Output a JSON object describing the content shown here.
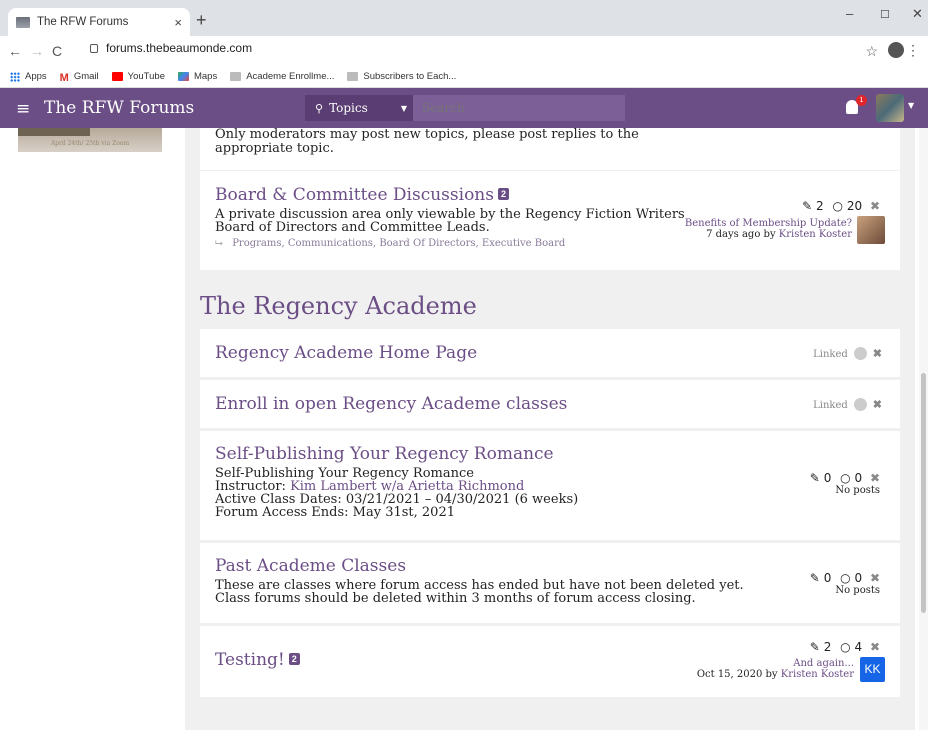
{
  "browser": {
    "tab_title": "The RFW Forums",
    "tab_close": "×",
    "new_tab": "+",
    "url": "forums.thebeaumonde.com",
    "min": "–",
    "max": "☐",
    "close": "✕",
    "bookmarks": [
      "Apps",
      "Gmail",
      "YouTube",
      "Maps",
      "Academe Enrollme...",
      "Subscribers to Each..."
    ]
  },
  "header": {
    "brand": "The RFW Forums",
    "search_scope": "Topics",
    "search_placeholder": "Search",
    "notif_count": "1"
  },
  "sidebar": {
    "banner_text": "April 24th/ 25th via Zoom"
  },
  "cards": {
    "top_text": "Only moderators may post new topics, please post replies to the appropriate topic.",
    "board": {
      "title": "Board & Committee Discussions",
      "unread": "2",
      "desc": "A private discussion area only viewable by the Regency Fiction Writers Board of Directors and Committee Leads.",
      "subs": [
        "Programs,",
        "Communications,",
        "Board Of Directors,",
        "Executive Board"
      ],
      "topics": "2",
      "posts": "20",
      "last_title": "Benefits of Membership Update?",
      "last_time": "7 days ago by",
      "last_user": "Kristen Koster"
    },
    "section_title": "The Regency Academe",
    "home": {
      "title": "Regency Academe Home Page",
      "linked": "Linked"
    },
    "enroll": {
      "title": "Enroll in open Regency Academe classes",
      "linked": "Linked"
    },
    "selfpub": {
      "title": "Self-Publishing Your Regency Romance",
      "line1": "Self-Publishing Your Regency Romance",
      "instr_label": "Instructor:",
      "instr_name": "Kim Lambert w/a Arietta Richmond",
      "dates": "Active Class Dates: 03/21/2021 – 04/30/2021 (6 weeks)",
      "ends": "Forum Access Ends: May 31st, 2021",
      "topics": "0",
      "posts": "0",
      "noposts": "No posts"
    },
    "past": {
      "title": "Past Academe Classes",
      "line1": "These are classes where forum access has ended but have not been deleted yet.",
      "line2": "Class forums should be deleted within 3 months of forum access closing.",
      "topics": "0",
      "posts": "0",
      "noposts": "No posts"
    },
    "testing": {
      "title": "Testing!",
      "unread": "2",
      "topics": "2",
      "posts": "4",
      "last_title": "And again...",
      "last_time": "Oct 15, 2020 by",
      "last_user": "Kristen Koster",
      "avatar_initials": "KK"
    }
  },
  "colors": {
    "brand": "#6b4e86",
    "kk": "#1565e6"
  }
}
